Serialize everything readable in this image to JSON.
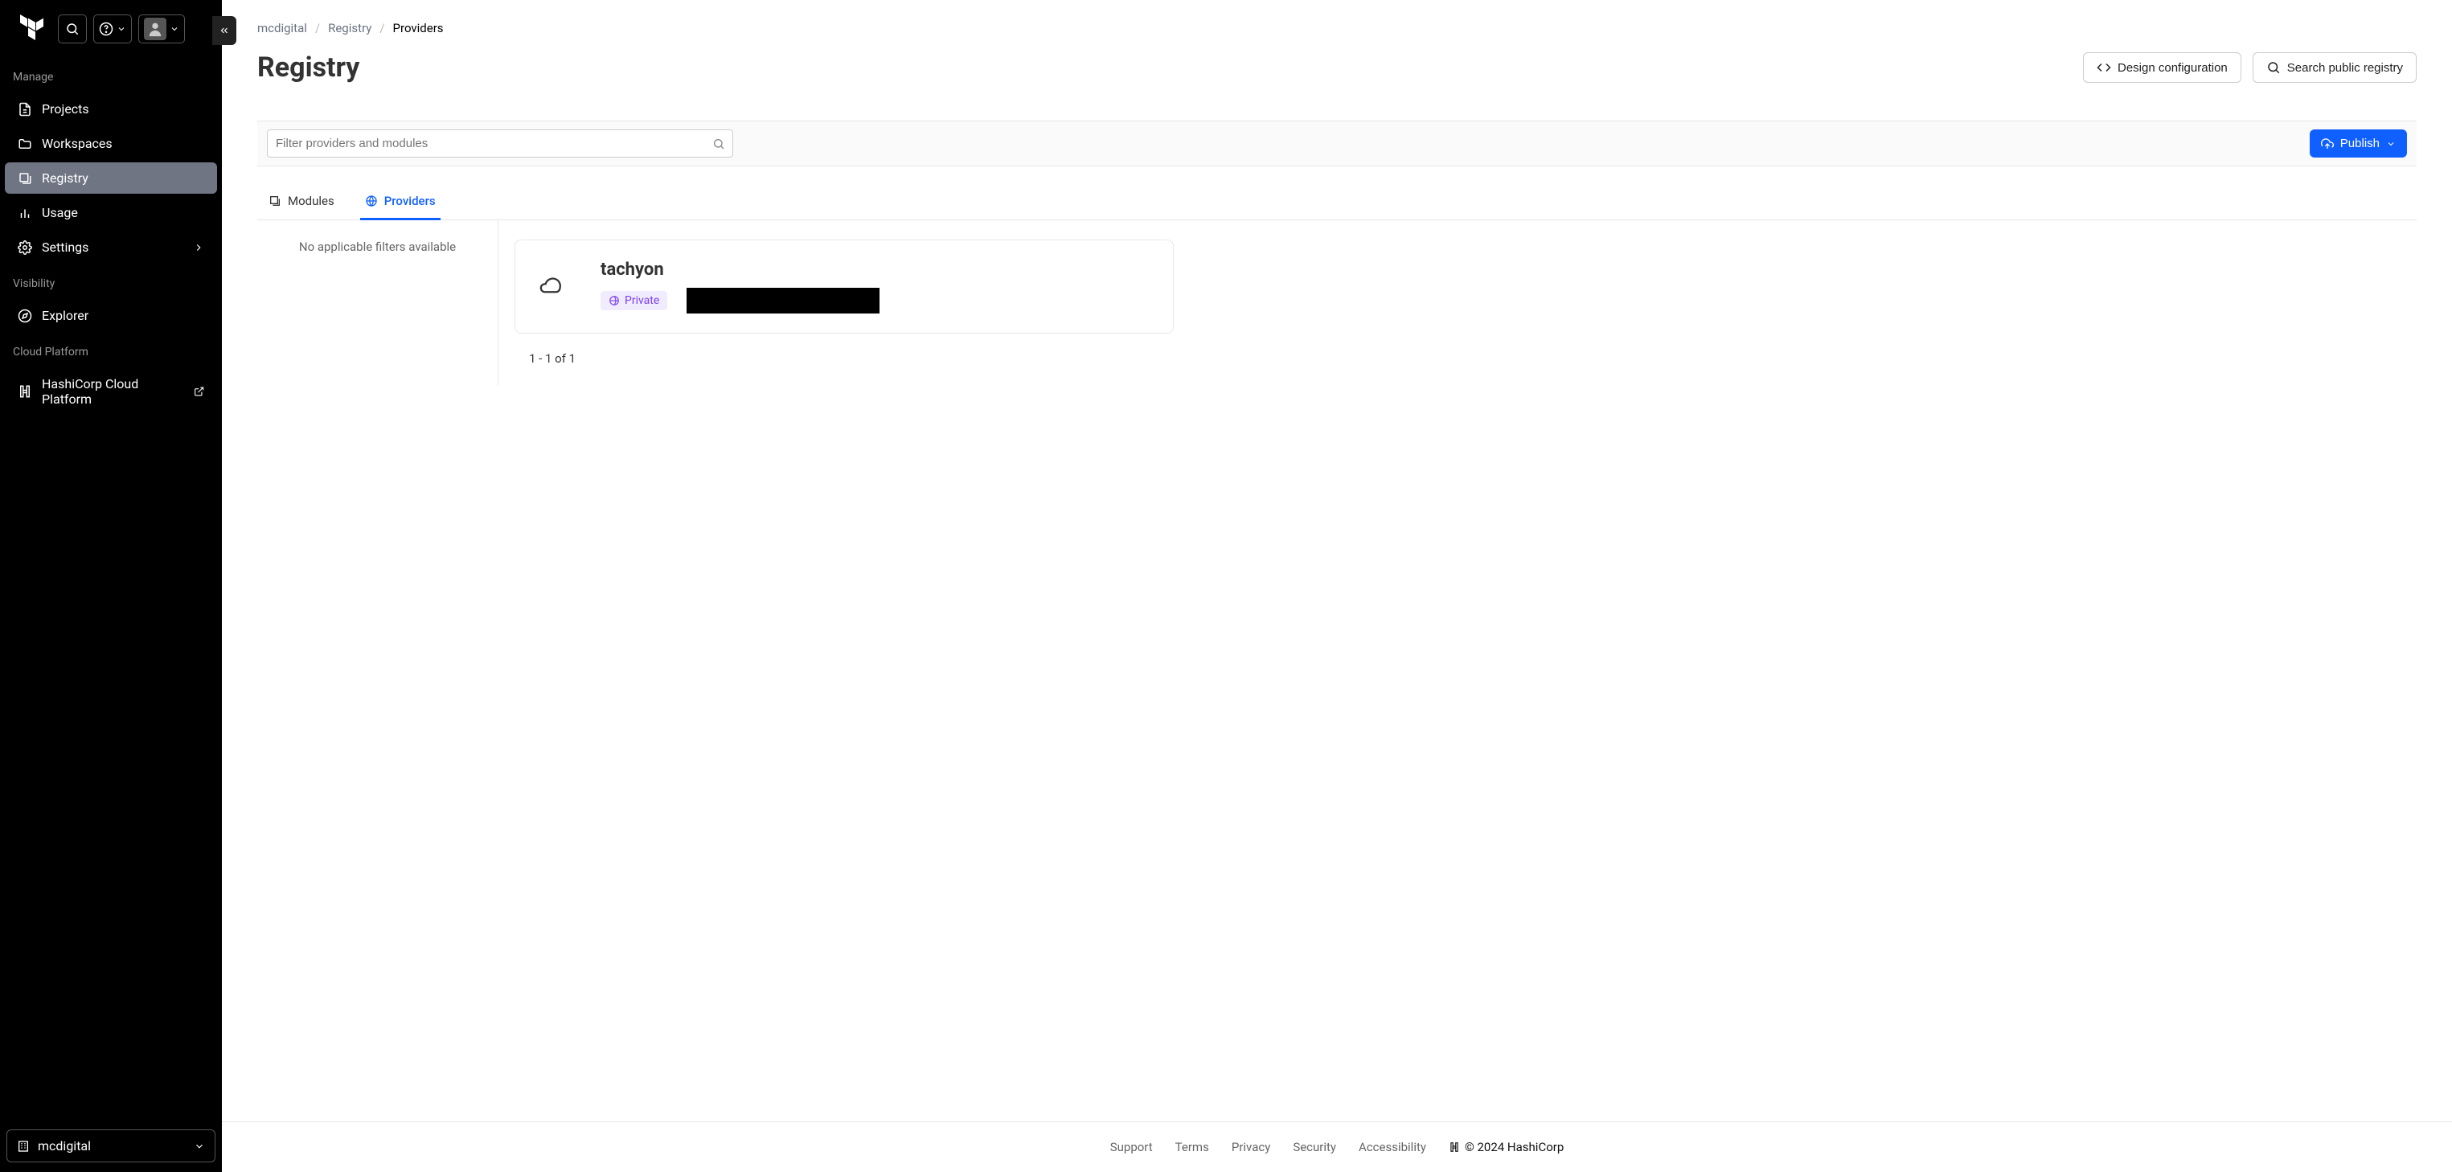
{
  "sidebar": {
    "sections": {
      "manage": {
        "label": "Manage"
      },
      "visibility": {
        "label": "Visibility"
      },
      "cloud": {
        "label": "Cloud Platform"
      }
    },
    "items": {
      "projects": "Projects",
      "workspaces": "Workspaces",
      "registry": "Registry",
      "usage": "Usage",
      "settings": "Settings",
      "explorer": "Explorer",
      "hcp": "HashiCorp Cloud Platform"
    },
    "org": "mcdigital"
  },
  "breadcrumbs": {
    "org": "mcdigital",
    "section": "Registry",
    "current": "Providers"
  },
  "page": {
    "title": "Registry"
  },
  "actions": {
    "design": "Design configuration",
    "searchPublic": "Search public registry",
    "publish": "Publish"
  },
  "filter": {
    "placeholder": "Filter providers and modules"
  },
  "tabs": {
    "modules": "Modules",
    "providers": "Providers"
  },
  "filters_panel": {
    "message": "No applicable filters available"
  },
  "results": {
    "items": [
      {
        "name": "tachyon",
        "badge": "Private",
        "redacted": true
      }
    ],
    "pagination": "1 - 1 of 1"
  },
  "footer": {
    "links": {
      "support": "Support",
      "terms": "Terms",
      "privacy": "Privacy",
      "security": "Security",
      "accessibility": "Accessibility"
    },
    "copyright": "© 2024 HashiCorp"
  }
}
